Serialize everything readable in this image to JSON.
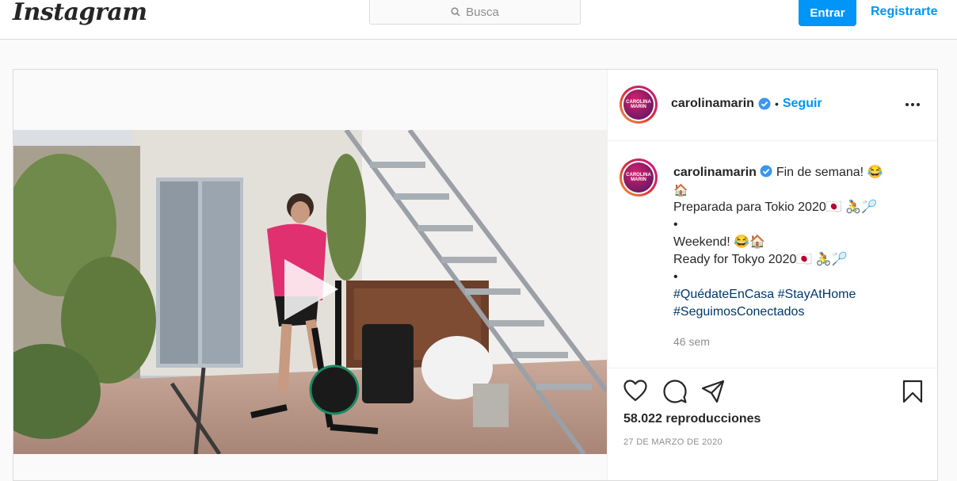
{
  "topbar": {
    "logo": "Instagram",
    "search_placeholder": "Busca",
    "login_label": "Entrar",
    "register_label": "Registrarte"
  },
  "post": {
    "username": "carolinamarin",
    "separator": "•",
    "follow_label": "Seguir",
    "avatar_text_1": "CAROLINA",
    "avatar_text_2": "MARIN",
    "caption": {
      "line1": "Fin de semana! 😂",
      "line2": "🏠",
      "line3": "Preparada para Tokio 2020🇯🇵 🚴🏸",
      "line4": "•",
      "line5": "Weekend! 😂🏠",
      "line6": "Ready for Tokyo 2020🇯🇵 🚴🏸",
      "line7": "•",
      "hashtag1": "#QuédateEnCasa",
      "hashtag2": "#StayAtHome",
      "hashtag3": "#SeguimosConectados"
    },
    "time_ago": "46 sem",
    "views": "58.022 reproducciones",
    "date": "27 DE MARZO DE 2020"
  },
  "colors": {
    "accent": "#0095f6",
    "text": "#262626",
    "muted": "#8e8e8e",
    "border": "#dbdbdb",
    "hashtag": "#00376b"
  }
}
